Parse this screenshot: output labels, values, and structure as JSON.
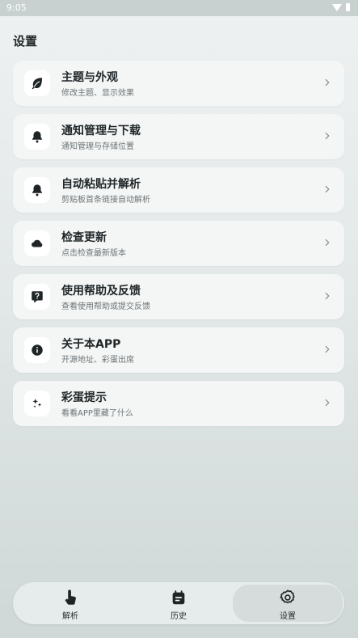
{
  "status_bar": {
    "time": "9:05"
  },
  "page": {
    "title": "设置"
  },
  "settings": [
    {
      "id": "theme",
      "icon": "leaf-icon",
      "title": "主题与外观",
      "subtitle": "修改主题、显示效果"
    },
    {
      "id": "notify",
      "icon": "bell-icon",
      "title": "通知管理与下载",
      "subtitle": "通知管理与存储位置"
    },
    {
      "id": "paste",
      "icon": "bell-icon",
      "title": "自动粘贴并解析",
      "subtitle": "剪贴板首条链接自动解析"
    },
    {
      "id": "update",
      "icon": "cloud-icon",
      "title": "检查更新",
      "subtitle": "点击检查最新版本"
    },
    {
      "id": "help",
      "icon": "help-chat-icon",
      "title": "使用帮助及反馈",
      "subtitle": "查看使用帮助或提交反馈"
    },
    {
      "id": "about",
      "icon": "info-icon",
      "title": "关于本APP",
      "subtitle": "开源地址、彩蛋出席"
    },
    {
      "id": "easter",
      "icon": "sparkles-icon",
      "title": "彩蛋提示",
      "subtitle": "看看APP里藏了什么"
    }
  ],
  "bottom_nav": {
    "items": [
      {
        "id": "parse",
        "icon": "tap-hand-icon",
        "label": "解析",
        "active": false
      },
      {
        "id": "history",
        "icon": "calendar-note-icon",
        "label": "历史",
        "active": false
      },
      {
        "id": "settings",
        "icon": "gear-icon",
        "label": "设置",
        "active": true
      }
    ]
  },
  "colors": {
    "card_bg": "#f4f6f6",
    "icon_color": "#1f2527",
    "active_tab_bg": "#d6dcdc"
  }
}
